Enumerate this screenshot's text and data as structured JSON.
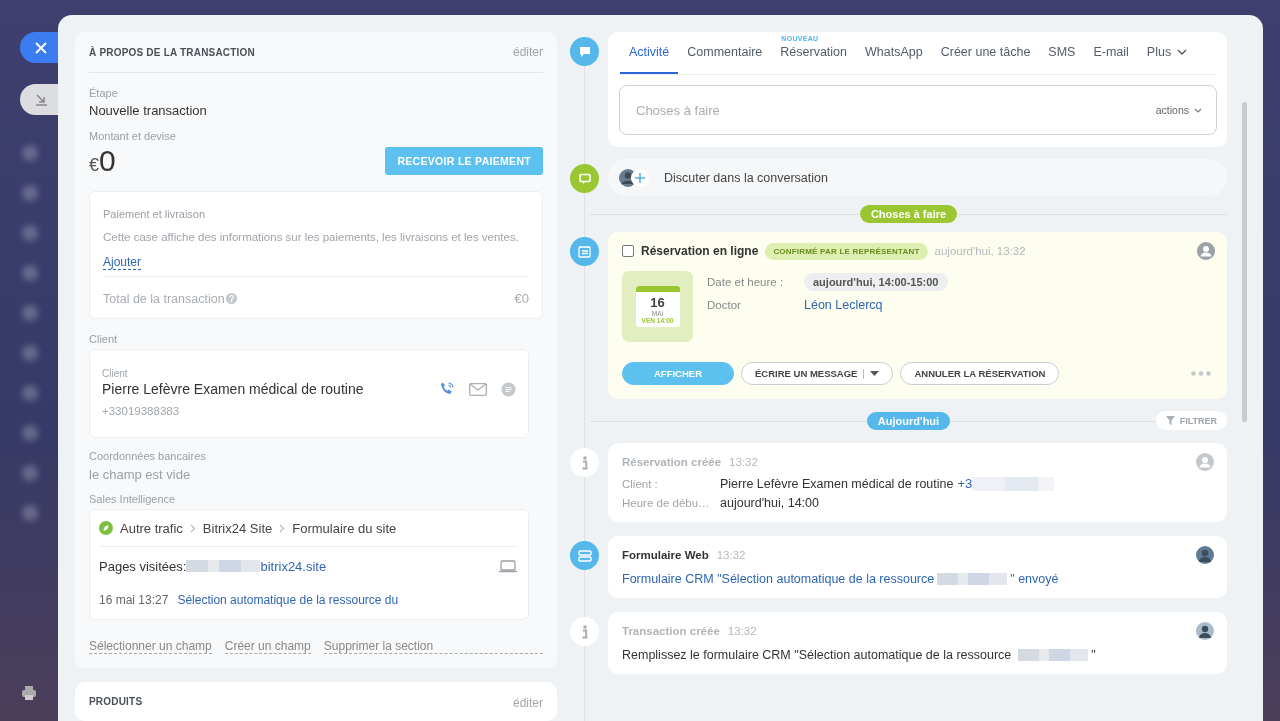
{
  "about": {
    "title": "À PROPOS DE LA TRANSACTION",
    "edit": "éditer",
    "stage_label": "Étape",
    "stage": "Nouvelle transaction",
    "amount_label": "Montant et devise",
    "currency": "€",
    "amount": "0",
    "pay_button": "RECEVOIR LE PAIEMENT",
    "payment_box": {
      "title": "Paiement et livraison",
      "text": "Cette case affiche des informations sur les paiements, les livraisons et les ventes.",
      "add_link": "Ajouter",
      "total_label": "Total de la transaction",
      "total": "€0"
    },
    "client_label": "Client",
    "client": {
      "label": "Client",
      "name": "Pierre Lefèvre Examen médical de routine",
      "phone": "+33019388383"
    },
    "bank_label": "Coordonnées bancaires",
    "bank_value": "le champ est vide",
    "si_label": "Sales Intelligence",
    "sales_intel": {
      "path": [
        "Autre trafic",
        "Bitrix24 Site",
        "Formulaire du site"
      ],
      "pages_label": "Pages visitées:",
      "pages_link": "bitrix24.site",
      "date": "16 mai 13:27",
      "link": "Sélection automatique de la ressource du"
    },
    "footer_links": [
      "Sélectionner un champ",
      "Créer un champ"
    ],
    "delete_link": "Supprimer la section"
  },
  "products": {
    "title": "PRODUITS",
    "edit": "éditer"
  },
  "timeline": {
    "tabs": [
      {
        "label": "Activité",
        "selected": true
      },
      {
        "label": "Commentaire",
        "selected": false
      },
      {
        "label": "Réservation",
        "selected": false,
        "badge": "NOUVEAU"
      },
      {
        "label": "WhatsApp",
        "selected": false
      },
      {
        "label": "Créer une tâche",
        "selected": false
      },
      {
        "label": "SMS",
        "selected": false
      },
      {
        "label": "E-mail",
        "selected": false
      },
      {
        "label": "Plus",
        "selected": false,
        "kind": "menu"
      }
    ],
    "todo_placeholder": "Choses à faire",
    "actions": "actions",
    "chat": "Discuter dans la conversation",
    "todo_divider": "Choses à faire",
    "booking": {
      "checked": false,
      "title": "Réservation en ligne",
      "status": "CONFIRMÉ PAR LE REPRÉSENTANT",
      "time": "aujourd'hui, 13:32",
      "day": "16",
      "month": "MAI",
      "weekday_time": "VEN 14:00",
      "details": [
        {
          "label": "Date et heure :",
          "value": "aujourd'hui, 14:00-15:00",
          "kind": "pill"
        },
        {
          "label": "Doctor",
          "value": "Léon Leclercq",
          "kind": "link"
        }
      ],
      "buttons": [
        "AFFICHER",
        "ÉCRIRE UN MESSAGE",
        "ANNULER LA RÉSERVATION"
      ]
    },
    "today_divider": "Aujourd'hui",
    "filter": "FILTRER",
    "events": [
      {
        "kind": "info",
        "title": "Réservation créée",
        "time": "13:32",
        "fields": [
          {
            "label": "Client :",
            "value": "Pierre Lefèvre Examen médical de routine",
            "link": "+3"
          },
          {
            "label": "Heure de débu…",
            "value": "aujourd'hui, 14:00"
          }
        ]
      },
      {
        "kind": "form",
        "title": "Formulaire Web",
        "time": "13:32",
        "text_before": "Formulaire CRM \"Sélection automatique de la ressource",
        "text_after": "\" envoyé"
      },
      {
        "kind": "info",
        "title": "Transaction créée",
        "time": "13:32",
        "text_before": "Remplissez le formulaire CRM \"Sélection automatique de la ressource",
        "text_after": "\""
      }
    ]
  }
}
